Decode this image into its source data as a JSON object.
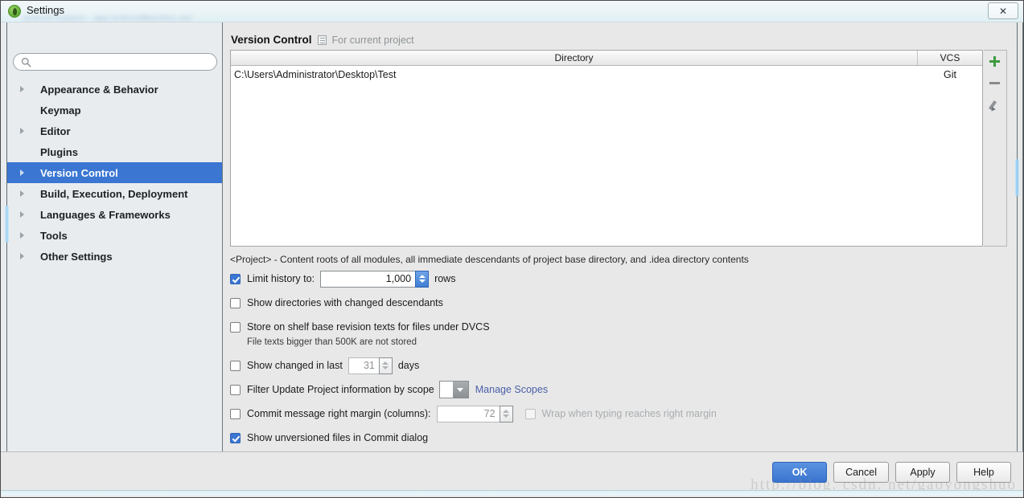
{
  "window": {
    "title": "Settings",
    "app_icon": "android-studio-icon",
    "close_label": "✕",
    "background_blur_text": "android support  -  app  AndroidManifest.xml"
  },
  "search": {
    "value": "",
    "placeholder": "",
    "icon": "search-icon"
  },
  "sidebar": {
    "items": [
      {
        "label": "Appearance & Behavior",
        "expandable": true,
        "selected": false
      },
      {
        "label": "Keymap",
        "expandable": false,
        "selected": false
      },
      {
        "label": "Editor",
        "expandable": true,
        "selected": false
      },
      {
        "label": "Plugins",
        "expandable": false,
        "selected": false
      },
      {
        "label": "Version Control",
        "expandable": true,
        "selected": true
      },
      {
        "label": "Build, Execution, Deployment",
        "expandable": true,
        "selected": false
      },
      {
        "label": "Languages & Frameworks",
        "expandable": true,
        "selected": false
      },
      {
        "label": "Tools",
        "expandable": true,
        "selected": false
      },
      {
        "label": "Other Settings",
        "expandable": true,
        "selected": false
      }
    ]
  },
  "panel": {
    "title": "Version Control",
    "subtitle": "For current project",
    "scope_icon": "project-scope-icon"
  },
  "table": {
    "columns": [
      "Directory",
      "VCS"
    ],
    "rows": [
      {
        "directory": "C:\\Users\\Administrator\\Desktop\\Test",
        "vcs": "Git"
      }
    ],
    "note": "<Project> - Content roots of all modules, all immediate descendants of project base directory, and .idea directory contents",
    "toolbar": [
      {
        "name": "add-directory-button",
        "icon": "plus-icon"
      },
      {
        "name": "remove-directory-button",
        "icon": "minus-icon"
      },
      {
        "name": "edit-directory-button",
        "icon": "pencil-icon"
      }
    ]
  },
  "options": {
    "limit_history": {
      "label": "Limit history to:",
      "checked": true,
      "value": "1,000",
      "suffix": "rows"
    },
    "show_directories": {
      "label": "Show directories with changed descendants",
      "checked": false
    },
    "store_on_shelf": {
      "label": "Store on shelf base revision texts for files under DVCS",
      "checked": false,
      "sub": "File texts bigger than 500K are not stored"
    },
    "show_changed_in_last": {
      "label": "Show changed in last",
      "checked": false,
      "value": "31",
      "suffix": "days"
    },
    "filter_update_project": {
      "label": "Filter Update Project information by scope",
      "checked": false,
      "scope_value": "",
      "link": "Manage Scopes"
    },
    "commit_margin": {
      "label": "Commit message right margin (columns):",
      "checked": false,
      "value": "72",
      "wrap_label": "Wrap when typing reaches right margin",
      "wrap_checked": false
    },
    "show_unversioned": {
      "label": "Show unversioned files in Commit dialog",
      "checked": true
    }
  },
  "footer": {
    "buttons": [
      {
        "label": "OK",
        "primary": true
      },
      {
        "label": "Cancel",
        "primary": false
      },
      {
        "label": "Apply",
        "primary": false
      },
      {
        "label": "Help",
        "primary": false
      }
    ]
  },
  "watermark": "http://blog. csdn. net/gaoyongshuo",
  "colors": {
    "accent": "#3a76d2",
    "selection": "#3a76d2",
    "link": "#4a5fa8",
    "plus_green": "#3f9a3f",
    "panel_bg": "#e8e8e8",
    "sidebar_bg": "#e9ecef"
  }
}
